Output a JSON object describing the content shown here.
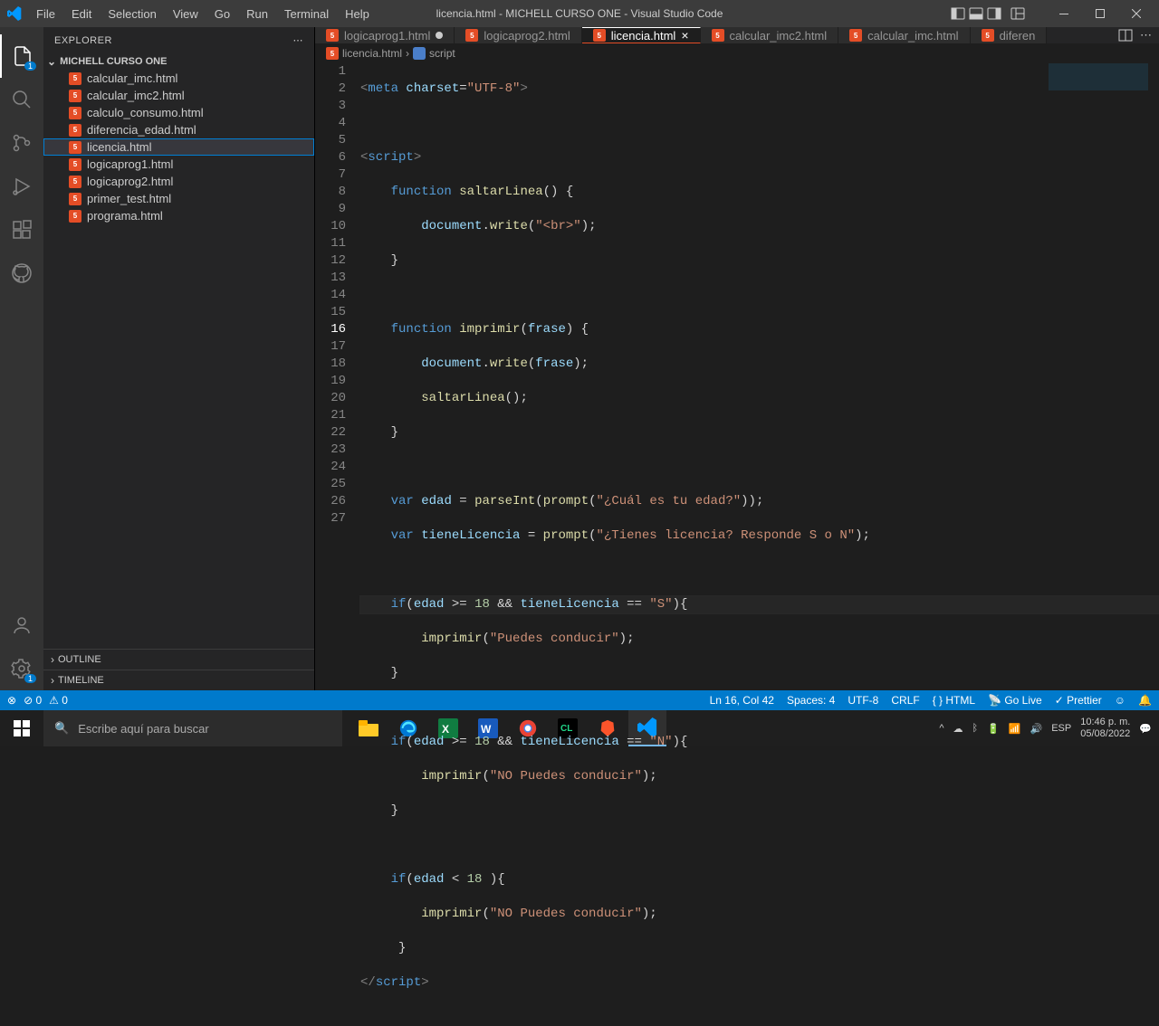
{
  "window": {
    "title": "licencia.html - MICHELL CURSO ONE - Visual Studio Code"
  },
  "menu": [
    "File",
    "Edit",
    "Selection",
    "View",
    "Go",
    "Run",
    "Terminal",
    "Help"
  ],
  "sidebar": {
    "title": "EXPLORER",
    "folder": "MICHELL CURSO ONE",
    "files": [
      "calcular_imc.html",
      "calcular_imc2.html",
      "calculo_consumo.html",
      "diferencia_edad.html",
      "licencia.html",
      "logicaprog1.html",
      "logicaprog2.html",
      "primer_test.html",
      "programa.html"
    ],
    "selectedIndex": 4,
    "outline": "OUTLINE",
    "timeline": "TIMELINE"
  },
  "tabs": [
    {
      "name": "logicaprog1.html",
      "modified": true
    },
    {
      "name": "logicaprog2.html"
    },
    {
      "name": "licencia.html",
      "active": true
    },
    {
      "name": "calcular_imc2.html"
    },
    {
      "name": "calcular_imc.html"
    },
    {
      "name": "diferen"
    }
  ],
  "breadcrumb": {
    "file": "licencia.html",
    "node": "script"
  },
  "status": {
    "errors": "0",
    "warnings": "0",
    "lncol": "Ln 16, Col 42",
    "spaces": "Spaces: 4",
    "encoding": "UTF-8",
    "eol": "CRLF",
    "lang": "HTML",
    "golive": "Go Live",
    "prettier": "Prettier"
  },
  "taskbar": {
    "search_placeholder": "Escribe aquí para buscar",
    "time": "10:46 p. m.",
    "date": "05/08/2022"
  },
  "code": {
    "lines": 27,
    "current": 16
  }
}
